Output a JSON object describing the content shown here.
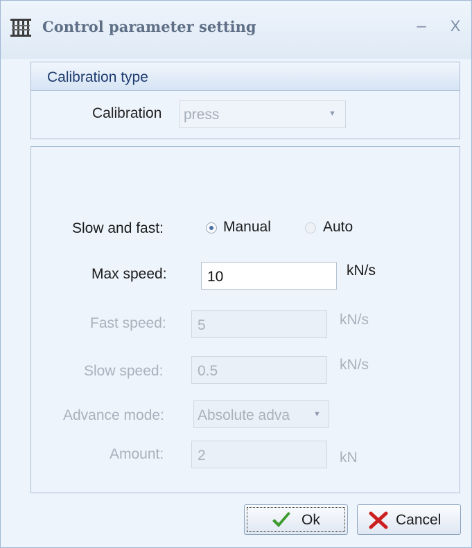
{
  "window": {
    "title": "Control parameter setting",
    "minimize_glyph": "–",
    "close_glyph": "X",
    "icon": "calibration-rack-icon"
  },
  "calibration_group": {
    "title": "Calibration type",
    "calibration_label": "Calibration",
    "calibration_value": "press"
  },
  "params": {
    "slow_fast_label": "Slow and fast:",
    "mode_options": [
      "Manual",
      "Auto"
    ],
    "selected_mode": "Manual",
    "max_speed_label": "Max speed:",
    "max_speed_value": "10",
    "max_speed_unit": "kN/s",
    "fast_speed_label": "Fast speed:",
    "fast_speed_value": "5",
    "fast_speed_unit": "kN/s",
    "slow_speed_label": "Slow speed:",
    "slow_speed_value": "0.5",
    "slow_speed_unit": "kN/s",
    "advance_mode_label": "Advance mode:",
    "advance_mode_value": "Absolute adva",
    "amount_label": "Amount:",
    "amount_value": "2",
    "amount_unit": "kN"
  },
  "buttons": {
    "ok_label": "Ok",
    "cancel_label": "Cancel"
  },
  "colors": {
    "ok_icon": "#3c9a2e",
    "cancel_icon": "#cc1f1f",
    "accent": "#1e3b6e"
  }
}
